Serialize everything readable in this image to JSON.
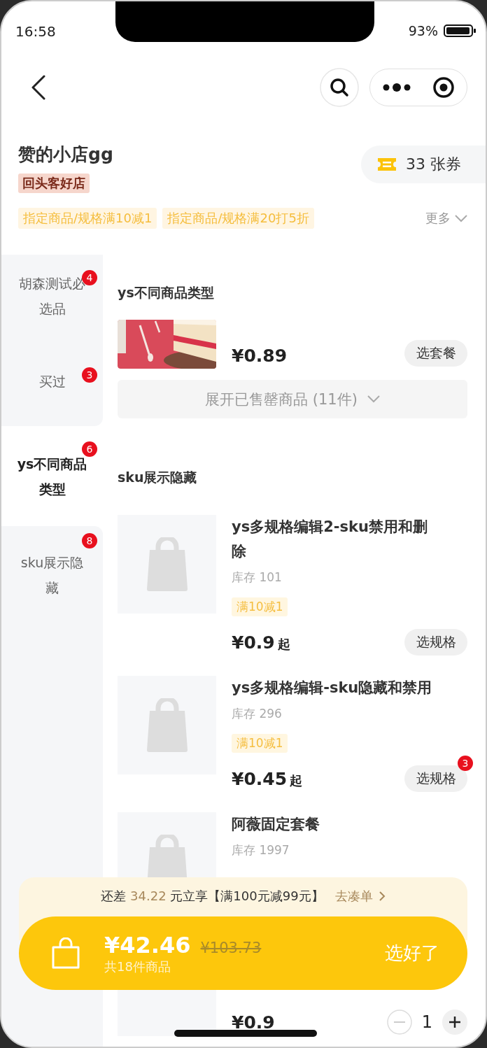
{
  "status_bar": {
    "time": "16:58",
    "battery": "93%"
  },
  "shop": {
    "name": "赞的小店gg",
    "badge": "回头客好店",
    "coupons": "33 张券"
  },
  "promotions": {
    "tags": [
      "指定商品/规格满10减1",
      "指定商品/规格满20打5折"
    ],
    "more": "更多"
  },
  "categories": [
    {
      "label": "胡森测试必选品",
      "count": "4",
      "selected": false
    },
    {
      "label": "买过",
      "count": "3",
      "selected": false
    },
    {
      "label": "ys不同商品类型",
      "count": "6",
      "selected": true
    },
    {
      "label": "sku展示隐藏",
      "count": "8",
      "selected": false
    }
  ],
  "sections": [
    {
      "title": "ys不同商品类型",
      "products": [
        {
          "kind": "picture",
          "price": "¥0.89",
          "button": "选套餐"
        }
      ],
      "expand": "展开已售罄商品 (11件)"
    },
    {
      "title": "sku展示隐藏",
      "products": [
        {
          "kind": "placeholder",
          "title": "ys多规格编辑2-sku禁用和删除",
          "stock": "库存 101",
          "tag": "满10减1",
          "price": "¥0.9",
          "price_suffix": "起",
          "button": "选规格"
        },
        {
          "kind": "placeholder",
          "title": "ys多规格编辑-sku隐藏和禁用",
          "stock": "库存 296",
          "tag": "满10减1",
          "price": "¥0.45",
          "price_suffix": "起",
          "button": "选规格",
          "badge": "3"
        },
        {
          "kind": "placeholder",
          "title": "阿薇固定套餐",
          "stock": "库存 1997"
        },
        {
          "kind": "placeholder",
          "price": "¥0.9",
          "quantity": "1"
        }
      ]
    }
  ],
  "discount_bar": {
    "prefix": "还差",
    "amount": "34.22",
    "middle": "元立享【满100元减99元】",
    "action": "去凑单"
  },
  "cart": {
    "total": "¥42.46",
    "original": "¥103.73",
    "count": "共18件商品",
    "checkout": "选好了"
  }
}
